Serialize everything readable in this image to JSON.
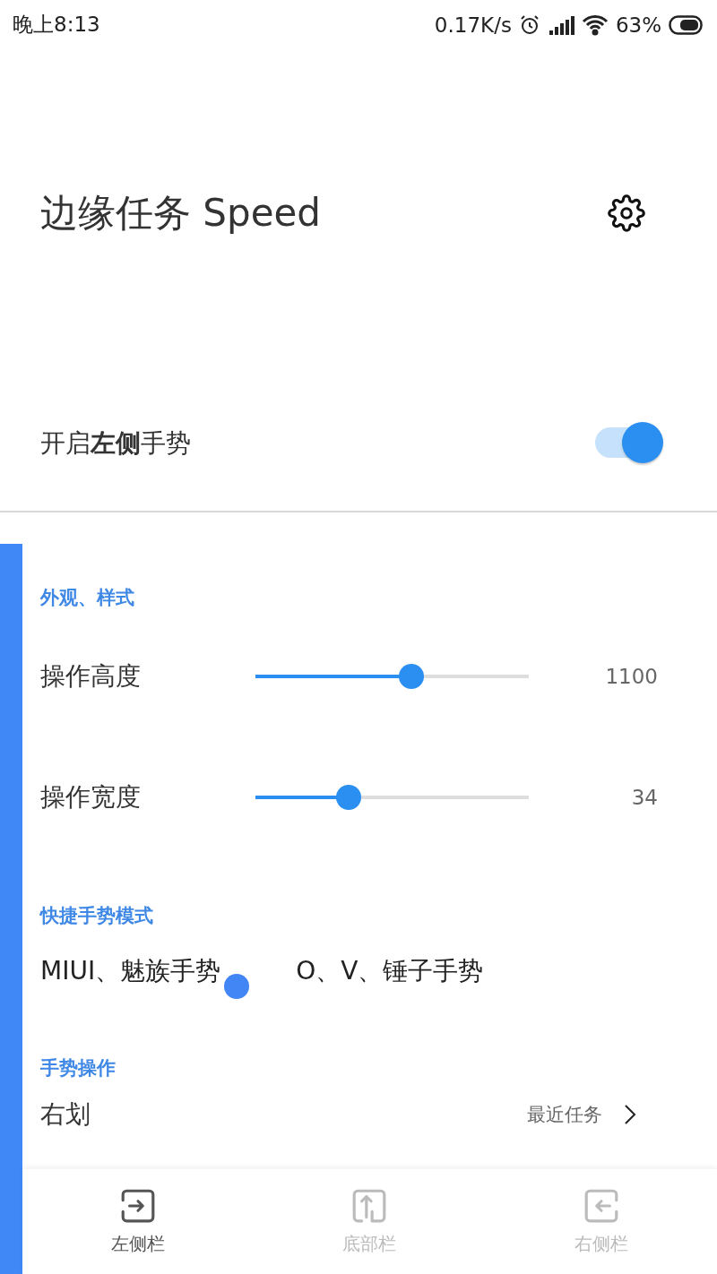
{
  "status_bar": {
    "time": "晚上8:13",
    "speed": "0.17K/s",
    "battery": "63%"
  },
  "header": {
    "title": "边缘任务 Speed"
  },
  "toggle": {
    "label": "开启**左侧**手势",
    "on": true
  },
  "sections": [
    {
      "heading": "外观、样式",
      "kind": "sliders",
      "sliders": [
        {
          "label": "操作高度",
          "level": 0.57,
          "reading": "1100"
        },
        {
          "label": "操作宽度",
          "level": 0.34,
          "reading": "34"
        }
      ]
    },
    {
      "heading": "快捷手势模式",
      "kind": "modes",
      "modes": [
        {
          "label": "MIUI、魅族手势",
          "selected": true
        },
        {
          "label": "O、V、锤子手势",
          "selected": false
        }
      ]
    },
    {
      "heading": "手势操作",
      "kind": "actions",
      "actions": [
        {
          "label": "右划",
          "value": "最近任务"
        }
      ]
    }
  ],
  "nav": [
    {
      "label": "左侧栏",
      "selected": true,
      "kind": "left"
    },
    {
      "label": "底部栏",
      "selected": false,
      "kind": "bottom"
    },
    {
      "label": "右侧栏",
      "selected": false,
      "kind": "right"
    }
  ]
}
